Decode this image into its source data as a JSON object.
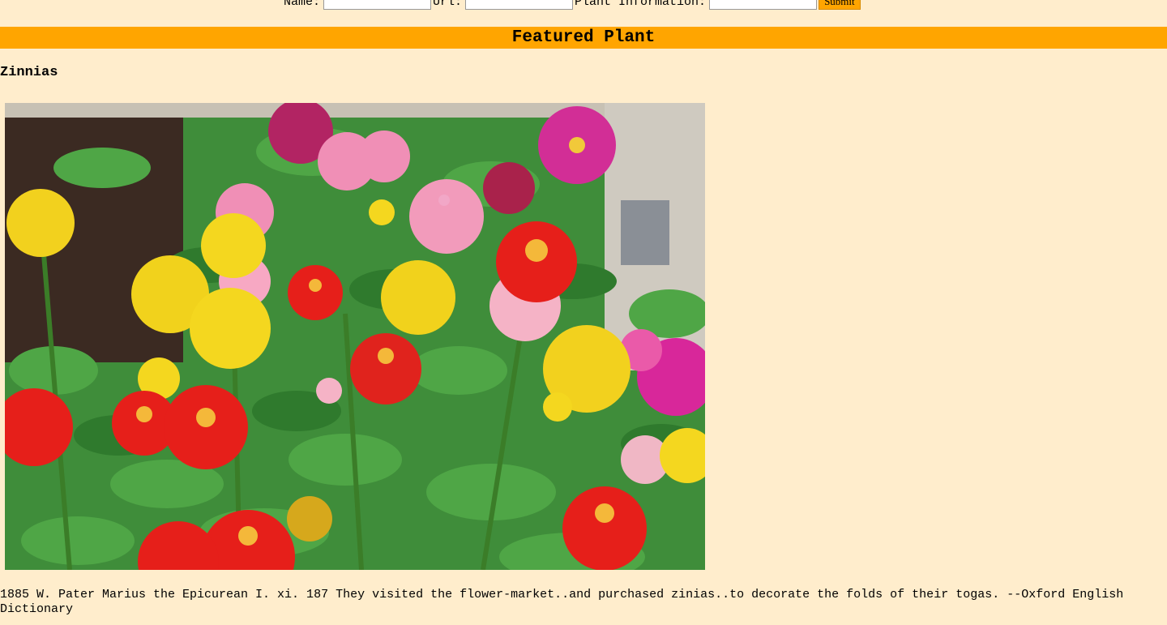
{
  "form": {
    "name_label": "Name:",
    "url_label": "Url:",
    "info_label": "Plant Information:",
    "name_value": "",
    "url_value": "",
    "info_value": "",
    "submit_label": "Submit"
  },
  "banner": {
    "title": "Featured Plant"
  },
  "plant": {
    "name": "Zinnias",
    "image_alt": "Zinnias",
    "quote": "1885 W. Pater Marius the Epicurean I. xi. 187 They visited the flower-market..and purchased zinias..to decorate the folds of their togas. --Oxford English Dictionary"
  },
  "colors": {
    "background": "#ffedcc",
    "accent": "#ffa500"
  }
}
